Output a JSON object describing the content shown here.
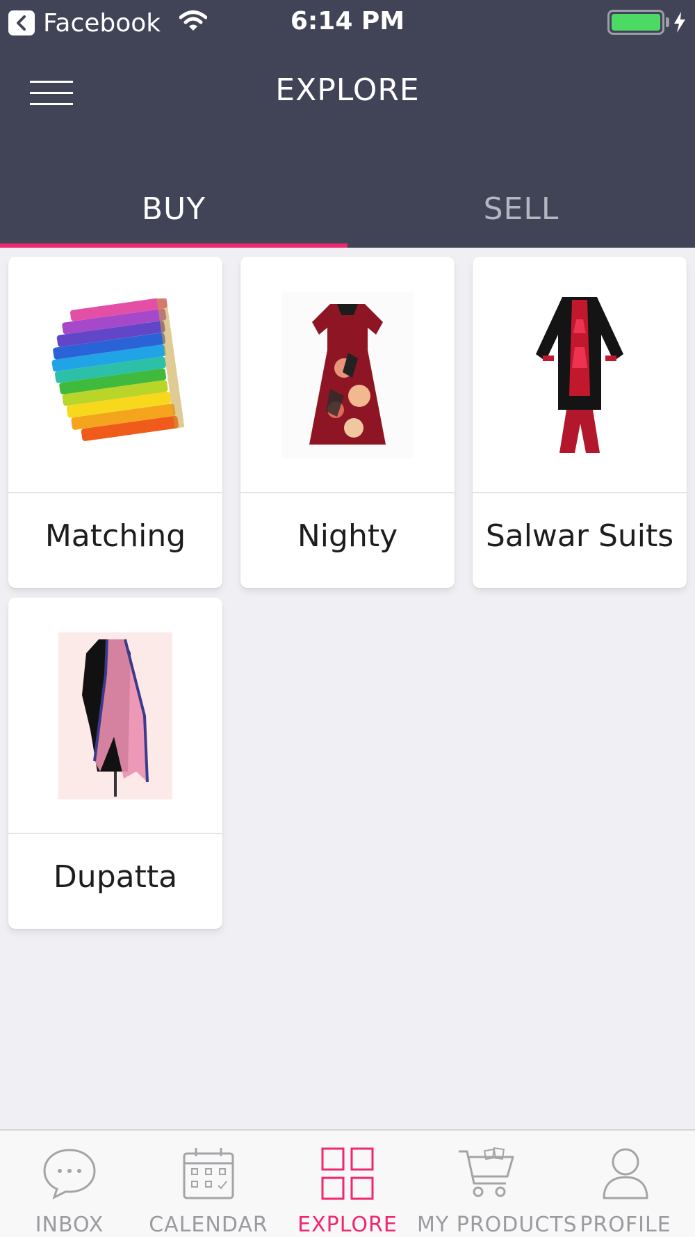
{
  "status_bar": {
    "back_app": "Facebook",
    "time": "6:14 PM",
    "battery_color": "#4cd964"
  },
  "header": {
    "title": "EXPLORE",
    "menu_icon": "hamburger-menu-icon",
    "background": "#414357"
  },
  "tabs": [
    {
      "label": "BUY",
      "active": true
    },
    {
      "label": "SELL",
      "active": false
    }
  ],
  "accent_color": "#f0266f",
  "categories": [
    {
      "label": "Matching",
      "image": "stacked-colorful-fabric-image"
    },
    {
      "label": "Nighty",
      "image": "red-floral-nighty-dress-image"
    },
    {
      "label": "Salwar Suits",
      "image": "black-red-salwar-suit-image"
    },
    {
      "label": "Dupatta",
      "image": "pink-dupatta-on-mannequin-image"
    }
  ],
  "bottom_nav": [
    {
      "label": "INBOX",
      "icon": "chat-bubble-icon",
      "active": false
    },
    {
      "label": "CALENDAR",
      "icon": "calendar-icon",
      "active": false
    },
    {
      "label": "EXPLORE",
      "icon": "grid-icon",
      "active": true
    },
    {
      "label": "MY PRODUCTS",
      "icon": "shopping-cart-icon",
      "active": false
    },
    {
      "label": "PROFILE",
      "icon": "person-icon",
      "active": false
    }
  ]
}
